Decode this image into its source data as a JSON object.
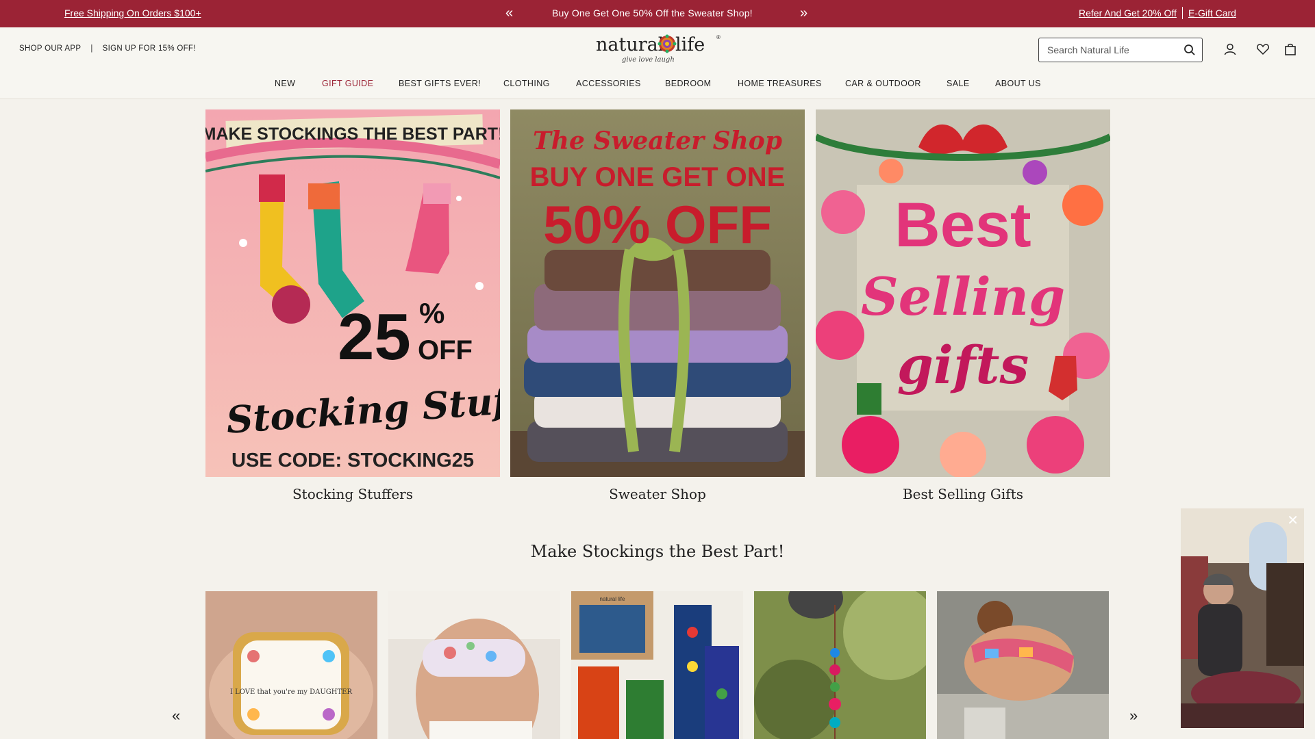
{
  "topbar": {
    "left_link": "Free Shipping On Orders $100+",
    "promo_prev_icon": "chevron-double-left-icon",
    "promo_text": "Buy One Get One 50% Off the Sweater Shop!",
    "promo_next_icon": "chevron-double-right-icon",
    "right_links": [
      "Refer And Get 20% Off",
      "E-Gift Card"
    ]
  },
  "header": {
    "utility": [
      "SHOP OUR APP",
      "|",
      "SIGN UP FOR 15% OFF!"
    ],
    "logo": {
      "word1": "natural",
      "word2": "life",
      "tagline": "give love laugh",
      "reg": "®"
    },
    "search": {
      "placeholder": "Search Natural Life",
      "icon": "search-icon"
    },
    "icons": [
      "account-icon",
      "wishlist-heart-icon",
      "cart-bag-icon"
    ]
  },
  "nav": {
    "items": [
      "NEW",
      "GIFT GUIDE",
      "BEST GIFTS EVER!",
      "CLOTHING",
      "ACCESSORIES",
      "BEDROOM",
      "HOME TREASURES",
      "CAR & OUTDOOR",
      "SALE",
      "ABOUT US"
    ],
    "active": "GIFT GUIDE",
    "active_color": "#9b2335"
  },
  "tiles": [
    {
      "caption": "Stocking Stuffers",
      "banner": "MAKE STOCKINGS THE BEST PART!",
      "big_number": "25",
      "percent": "%",
      "off": "OFF",
      "script": "Stocking Stuffers",
      "code": "USE CODE: STOCKING25"
    },
    {
      "caption": "Sweater Shop",
      "script": "The Sweater Shop",
      "line1": "BUY ONE GET ONE",
      "line2": "50% OFF"
    },
    {
      "caption": "Best Selling Gifts",
      "line1": "Best",
      "line2": "Selling",
      "line3": "gifts"
    }
  ],
  "section_title": "Make Stockings the Best Part!",
  "products": [
    {
      "name": "trinket-dish",
      "dish_text": "I LOVE that you're my DAUGHTER"
    },
    {
      "name": "eye-mask"
    },
    {
      "name": "cozy-socks-set",
      "box_text": "natural life"
    },
    {
      "name": "car-charm"
    },
    {
      "name": "headband"
    }
  ],
  "carousel": {
    "prev_icon": "chevron-double-left-icon",
    "next_icon": "chevron-double-right-icon"
  },
  "video_popup": {
    "close_icon": "close-icon"
  },
  "colors": {
    "brand": "#9b2335",
    "background": "#f4f2ec"
  }
}
